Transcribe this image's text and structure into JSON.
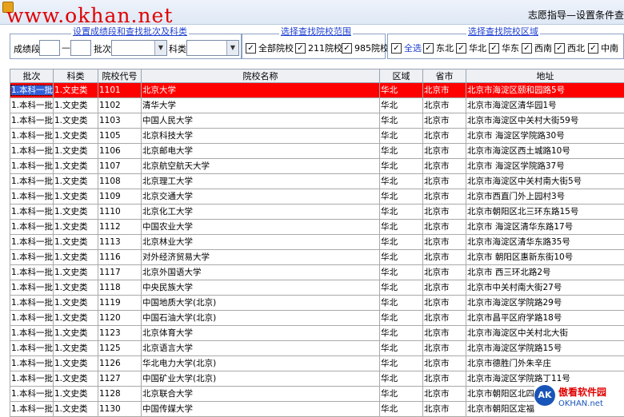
{
  "window": {
    "title": "志愿指导—设置条件查",
    "watermark": "www.okhan.net"
  },
  "filters": {
    "group1_title": "设置成绩段和查找批次及科类",
    "score_label": "成绩段",
    "score_from": "",
    "dash": "—",
    "score_to": "",
    "batch_label": "批次",
    "batch_value": "",
    "subject_label": "科类",
    "subject_value": "",
    "group2_title": "选择查找院校范围",
    "scope": [
      {
        "label": "全部院校",
        "checked": "✓"
      },
      {
        "label": "211院校",
        "checked": "✓"
      },
      {
        "label": "985院校",
        "checked": "✓"
      }
    ],
    "group3_title": "选择查找院校区域",
    "regions": [
      {
        "label": "全选",
        "checked": "✓"
      },
      {
        "label": "东北",
        "checked": "✓"
      },
      {
        "label": "华北",
        "checked": "✓"
      },
      {
        "label": "华东",
        "checked": "✓"
      },
      {
        "label": "西南",
        "checked": "✓"
      },
      {
        "label": "西北",
        "checked": "✓"
      },
      {
        "label": "中南",
        "checked": "✓"
      }
    ]
  },
  "table": {
    "headers": [
      "批次",
      "科类",
      "院校代号",
      "院校名称",
      "区域",
      "省市",
      "地址"
    ],
    "rows": [
      [
        "1.本科一批",
        "1.文史类",
        "1101",
        "北京大学",
        "华北",
        "北京市",
        "北京市海淀区颐和园路5号"
      ],
      [
        "1.本科一批",
        "1.文史类",
        "1102",
        "清华大学",
        "华北",
        "北京市",
        "北京市海淀区清华园1号"
      ],
      [
        "1.本科一批",
        "1.文史类",
        "1103",
        "中国人民大学",
        "华北",
        "北京市",
        "北京市海淀区中关村大街59号"
      ],
      [
        "1.本科一批",
        "1.文史类",
        "1105",
        "北京科技大学",
        "华北",
        "北京市",
        "北京市 海淀区学院路30号"
      ],
      [
        "1.本科一批",
        "1.文史类",
        "1106",
        "北京邮电大学",
        "华北",
        "北京市",
        "北京市海淀区西土城路10号"
      ],
      [
        "1.本科一批",
        "1.文史类",
        "1107",
        "北京航空航天大学",
        "华北",
        "北京市",
        "北京市 海淀区学院路37号"
      ],
      [
        "1.本科一批",
        "1.文史类",
        "1108",
        "北京理工大学",
        "华北",
        "北京市",
        "北京市海淀区中关村南大街5号"
      ],
      [
        "1.本科一批",
        "1.文史类",
        "1109",
        "北京交通大学",
        "华北",
        "北京市",
        "北京市西直门外上园村3号"
      ],
      [
        "1.本科一批",
        "1.文史类",
        "1110",
        "北京化工大学",
        "华北",
        "北京市",
        "北京市朝阳区北三环东路15号"
      ],
      [
        "1.本科一批",
        "1.文史类",
        "1112",
        "中国农业大学",
        "华北",
        "北京市",
        "北京市 海淀区清华东路17号"
      ],
      [
        "1.本科一批",
        "1.文史类",
        "1113",
        "北京林业大学",
        "华北",
        "北京市",
        "北京市海淀区清华东路35号"
      ],
      [
        "1.本科一批",
        "1.文史类",
        "1116",
        "对外经济贸易大学",
        "华北",
        "北京市",
        "北京市 朝阳区惠新东街10号"
      ],
      [
        "1.本科一批",
        "1.文史类",
        "1117",
        "北京外国语大学",
        "华北",
        "北京市",
        "北京市 西三环北路2号"
      ],
      [
        "1.本科一批",
        "1.文史类",
        "1118",
        "中央民族大学",
        "华北",
        "北京市",
        "北京市中关村南大街27号"
      ],
      [
        "1.本科一批",
        "1.文史类",
        "1119",
        "中国地质大学(北京)",
        "华北",
        "北京市",
        "北京市海淀区学院路29号"
      ],
      [
        "1.本科一批",
        "1.文史类",
        "1120",
        "中国石油大学(北京)",
        "华北",
        "北京市",
        "北京市昌平区府学路18号"
      ],
      [
        "1.本科一批",
        "1.文史类",
        "1123",
        "北京体育大学",
        "华北",
        "北京市",
        "北京市海淀区中关村北大街"
      ],
      [
        "1.本科一批",
        "1.文史类",
        "1125",
        "北京语言大学",
        "华北",
        "北京市",
        "北京市海淀区学院路15号"
      ],
      [
        "1.本科一批",
        "1.文史类",
        "1126",
        "华北电力大学(北京)",
        "华北",
        "北京市",
        "北京市德胜门外朱辛庄"
      ],
      [
        "1.本科一批",
        "1.文史类",
        "1127",
        "中国矿业大学(北京)",
        "华北",
        "北京市",
        "北京市海淀区学院路丁11号"
      ],
      [
        "1.本科一批",
        "1.文史类",
        "1128",
        "北京联合大学",
        "华北",
        "北京市",
        "北京市朝阳区北四环东路"
      ],
      [
        "1.本科一批",
        "1.文史类",
        "1130",
        "中国传媒大学",
        "华北",
        "北京市",
        "北京市朝阳区定福庄东街"
      ]
    ]
  },
  "badge": {
    "circle": "AK",
    "line1": "傲看软件园",
    "line2": "OKHAN.net"
  },
  "colors": {
    "selected_row": "#ff0000",
    "watermark": "#e00000",
    "link_blue": "#1d3fd0"
  }
}
